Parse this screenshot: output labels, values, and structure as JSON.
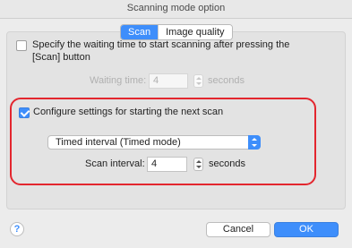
{
  "window": {
    "title": "Scanning mode option"
  },
  "tabs": [
    {
      "label": "Scan",
      "selected": true
    },
    {
      "label": "Image quality",
      "selected": false
    }
  ],
  "waiting": {
    "checkbox_label_line1": "Specify the waiting time to start scanning after pressing the",
    "checkbox_label_line2": "[Scan] button",
    "checked": false,
    "time_label": "Waiting time:",
    "time_value": "4",
    "unit": "seconds"
  },
  "next_scan": {
    "checkbox_label": "Configure settings for starting the next scan",
    "checked": true,
    "mode_selected": "Timed interval (Timed mode)",
    "interval_label": "Scan interval:",
    "interval_value": "4",
    "unit": "seconds"
  },
  "footer": {
    "help_label": "?",
    "cancel_label": "Cancel",
    "ok_label": "OK"
  },
  "colors": {
    "accent": "#3e8efb",
    "highlight_border": "#e3262e"
  }
}
